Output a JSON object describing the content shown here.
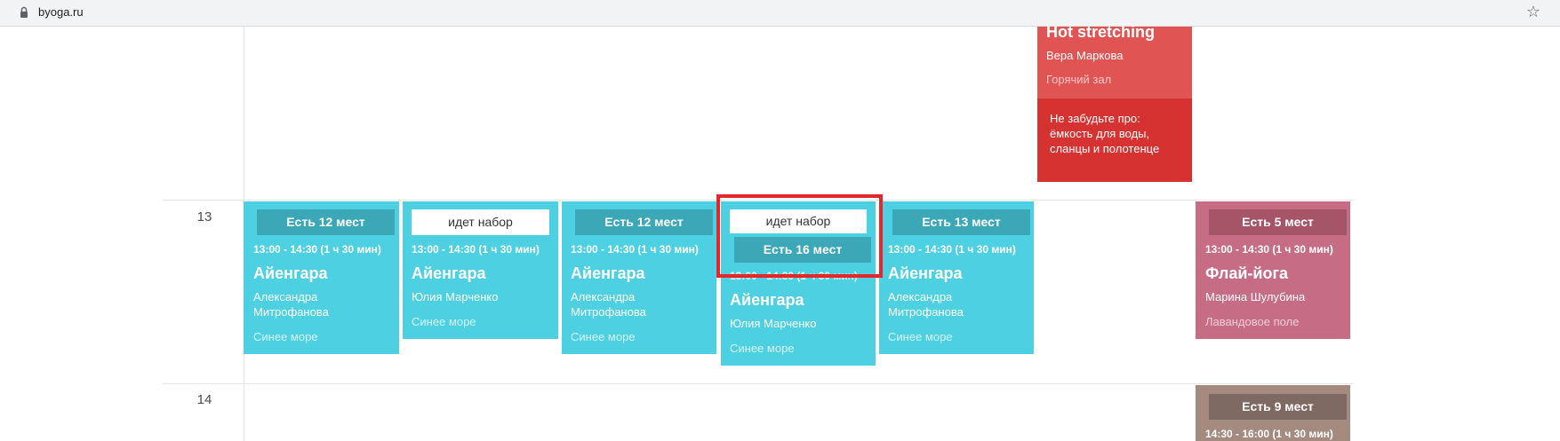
{
  "browser": {
    "url": "byoga.ru"
  },
  "schedule": {
    "hours": [
      "13",
      "14"
    ],
    "top_card": {
      "name": "Hot stretching",
      "teacher": "Вера Маркова",
      "room": "Горячий зал",
      "notice": "Не забудьте про: ёмкость для воды, сланцы и полотенце"
    },
    "row13": [
      {
        "badge": "Есть 12 мест",
        "time": "13:00 - 14:30 (1 ч 30 мин)",
        "name": "Айенгара",
        "teacher": "Александра Митрофанова",
        "room": "Синее море"
      },
      {
        "badge": "идет набор",
        "time": "13:00 - 14:30 (1 ч 30 мин)",
        "name": "Айенгара",
        "teacher": "Юлия Марченко",
        "room": "Синее море"
      },
      {
        "badge": "Есть 12 мест",
        "time": "13:00 - 14:30 (1 ч 30 мин)",
        "name": "Айенгара",
        "teacher": "Александра Митрофанова",
        "room": "Синее море"
      },
      {
        "badge": "идет набор",
        "badge2": "Есть 16 мест",
        "time": "13:00 - 14:30 (1 ч 30 мин)",
        "name": "Айенгара",
        "teacher": "Юлия Марченко",
        "room": "Синее море"
      },
      {
        "badge": "Есть 13 мест",
        "time": "13:00 - 14:30 (1 ч 30 мин)",
        "name": "Айенгара",
        "teacher": "Александра Митрофанова",
        "room": "Синее море"
      },
      {
        "badge": "Есть 5 мест",
        "time": "13:00 - 14:30 (1 ч 30 мин)",
        "name": "Флай-йога",
        "teacher": "Марина Шулубина",
        "room": "Лавандовое поле"
      }
    ],
    "row14": [
      {
        "badge": "Есть 9 мест",
        "time": "14:30 - 16:00 (1 ч 30 мин)"
      }
    ]
  }
}
